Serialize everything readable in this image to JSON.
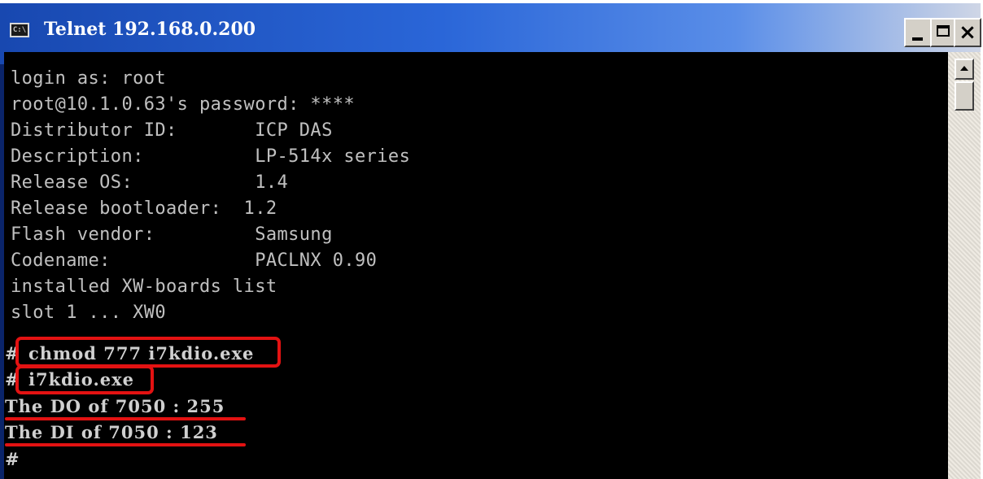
{
  "window": {
    "title": "Telnet 192.168.0.200",
    "icon": "console-icon",
    "icon_text": "C:\\",
    "controls": {
      "minimize": "minimize-icon",
      "maximize": "maximize-icon",
      "close": "close-icon",
      "close_glyph": "×"
    }
  },
  "terminal": {
    "lines": [
      "login as: root",
      "root@10.1.0.63's password: ****",
      "Distributor ID:       ICP DAS",
      "Description:          LP-514x series",
      "Release OS:           1.4",
      "Release bootloader:  1.2",
      "Flash vendor:         Samsung",
      "Codename:             PACLNX 0.90",
      "installed XW-boards list",
      "slot 1 ... XW0"
    ],
    "command1": {
      "prompt": "#",
      "text": "chmod 777 i7kdio.exe"
    },
    "command2": {
      "prompt": "#",
      "text": "i7kdio.exe"
    },
    "output": [
      "The DO of 7050 : 255",
      "The DI of 7050 : 123"
    ],
    "final_prompt": "#"
  },
  "colors": {
    "terminal_bg": "#000000",
    "terminal_fg": "#c0c0c0",
    "highlight": "#e31212",
    "titlebar": "#2a66d8"
  }
}
